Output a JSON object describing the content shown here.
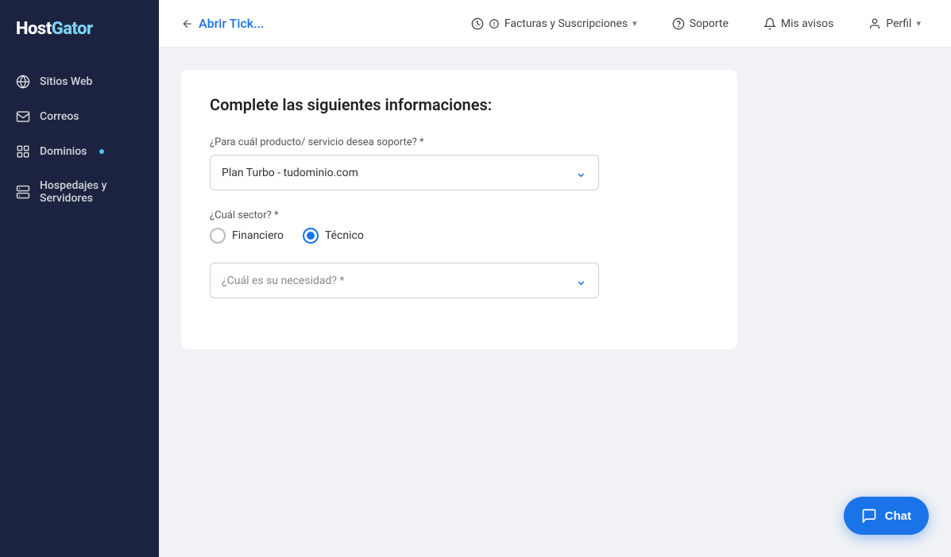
{
  "sidebar": {
    "logo": "HostGator",
    "items": [
      {
        "id": "sitios-web",
        "label": "Sitios Web",
        "icon": "globe-icon",
        "hasDot": false
      },
      {
        "id": "correos",
        "label": "Correos",
        "icon": "mail-icon",
        "hasDot": false
      },
      {
        "id": "dominios",
        "label": "Dominios",
        "icon": "grid-icon",
        "hasDot": true
      },
      {
        "id": "hospedajes",
        "label": "Hospedajes y Servidores",
        "icon": "server-icon",
        "hasDot": false
      }
    ]
  },
  "header": {
    "back_arrow": "←",
    "title": "Abrir Tick...",
    "nav_items": [
      {
        "id": "facturas",
        "label": "Facturas y Suscripciones",
        "icon": "dollar-icon",
        "hasChevron": true
      },
      {
        "id": "soporte",
        "label": "Soporte",
        "icon": "question-icon",
        "hasChevron": false
      },
      {
        "id": "avisos",
        "label": "Mis avisos",
        "icon": "bell-icon",
        "hasChevron": false
      },
      {
        "id": "perfil",
        "label": "Perfil",
        "icon": "user-icon",
        "hasChevron": true
      }
    ]
  },
  "form": {
    "title": "Complete las siguientes informaciones:",
    "product_label": "¿Para cuál producto/ servicio desea soporte? *",
    "product_value": "Plan Turbo - tudominio.com",
    "sector_label": "¿Cuál sector? *",
    "sector_options": [
      {
        "id": "financiero",
        "label": "Financiero",
        "checked": false
      },
      {
        "id": "tecnico",
        "label": "Técnico",
        "checked": true
      }
    ],
    "need_placeholder": "¿Cuál es su necesidad? *"
  },
  "chat": {
    "label": "Chat"
  }
}
